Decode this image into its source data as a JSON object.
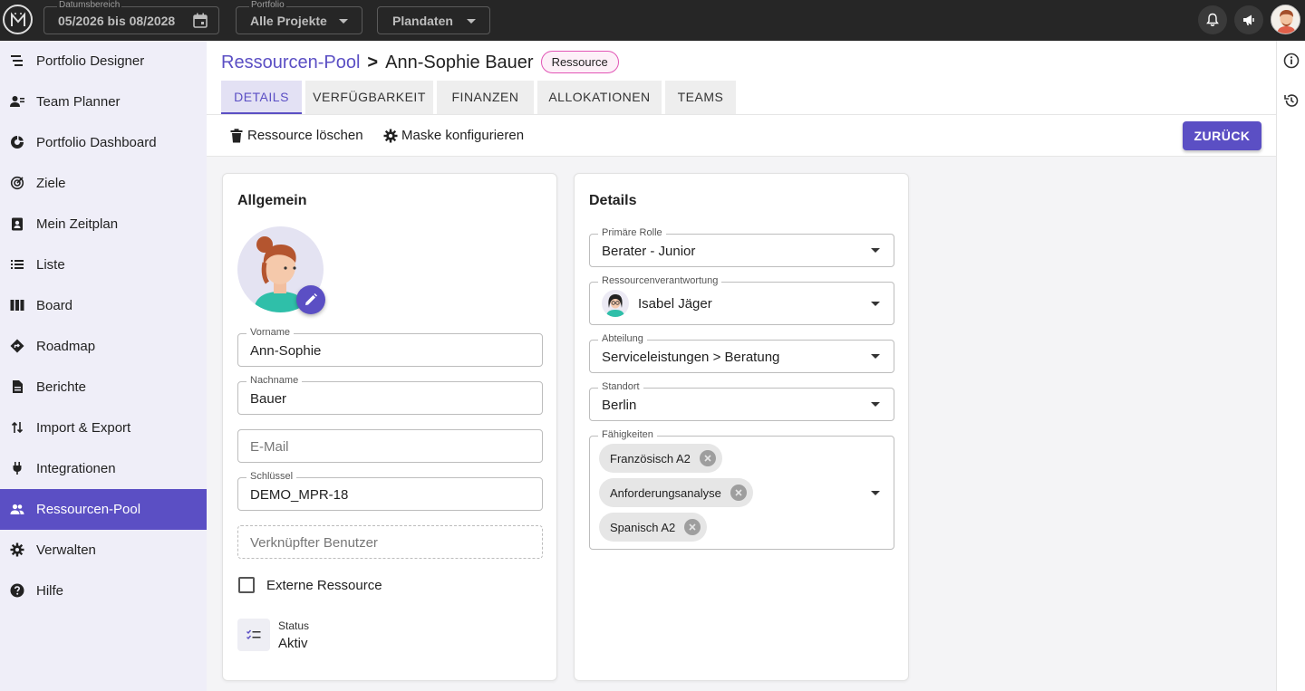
{
  "topbar": {
    "date_label": "Datumsbereich",
    "date_value": "05/2026 bis 08/2028",
    "portfolio_label": "Portfolio",
    "portfolio_value": "Alle Projekte",
    "plan_value": "Plandaten"
  },
  "sidebar": {
    "items": [
      {
        "label": "Portfolio Designer",
        "icon": "portfolio-designer-icon"
      },
      {
        "label": "Team Planner",
        "icon": "team-planner-icon"
      },
      {
        "label": "Portfolio Dashboard",
        "icon": "dashboard-icon"
      },
      {
        "label": "Ziele",
        "icon": "target-icon"
      },
      {
        "label": "Mein Zeitplan",
        "icon": "schedule-icon"
      },
      {
        "label": "Liste",
        "icon": "list-icon"
      },
      {
        "label": "Board",
        "icon": "board-icon"
      },
      {
        "label": "Roadmap",
        "icon": "roadmap-icon"
      },
      {
        "label": "Berichte",
        "icon": "report-icon"
      },
      {
        "label": "Import & Export",
        "icon": "import-export-icon"
      },
      {
        "label": "Integrationen",
        "icon": "plug-icon"
      },
      {
        "label": "Ressourcen-Pool",
        "icon": "people-icon",
        "active": true
      },
      {
        "label": "Verwalten",
        "icon": "gear-icon"
      },
      {
        "label": "Hilfe",
        "icon": "help-icon"
      }
    ]
  },
  "header": {
    "breadcrumb_link": "Ressourcen-Pool",
    "breadcrumb_sep": ">",
    "breadcrumb_current": "Ann-Sophie Bauer",
    "badge": "Ressource",
    "tabs": [
      {
        "label": "DETAILS",
        "active": true
      },
      {
        "label": "VERFÜGBARKEIT"
      },
      {
        "label": "FINANZEN"
      },
      {
        "label": "ALLOKATIONEN"
      },
      {
        "label": "TEAMS"
      }
    ],
    "delete_label": "Ressource löschen",
    "configure_label": "Maske konfigurieren",
    "back_label": "ZURÜCK"
  },
  "general": {
    "title": "Allgemein",
    "firstname_label": "Vorname",
    "firstname_value": "Ann-Sophie",
    "lastname_label": "Nachname",
    "lastname_value": "Bauer",
    "email_placeholder": "E-Mail",
    "key_label": "Schlüssel",
    "key_value": "DEMO_MPR-18",
    "linked_user_placeholder": "Verknüpfter Benutzer",
    "external_label": "Externe Ressource",
    "status_label": "Status",
    "status_value": "Aktiv"
  },
  "details": {
    "title": "Details",
    "role_label": "Primäre Rolle",
    "role_value": "Berater - Junior",
    "owner_label": "Ressourcenverantwortung",
    "owner_value": "Isabel Jäger",
    "department_label": "Abteilung",
    "department_value": "Serviceleistungen > Beratung",
    "location_label": "Standort",
    "location_value": "Berlin",
    "skills_label": "Fähigkeiten",
    "skills": [
      "Französisch A2",
      "Anforderungsanalyse",
      "Spanisch A2"
    ]
  },
  "colors": {
    "accent": "#5b4fc4",
    "topbar": "#262626",
    "sidebar": "#efeef8",
    "badge_border": "#e256b6"
  }
}
